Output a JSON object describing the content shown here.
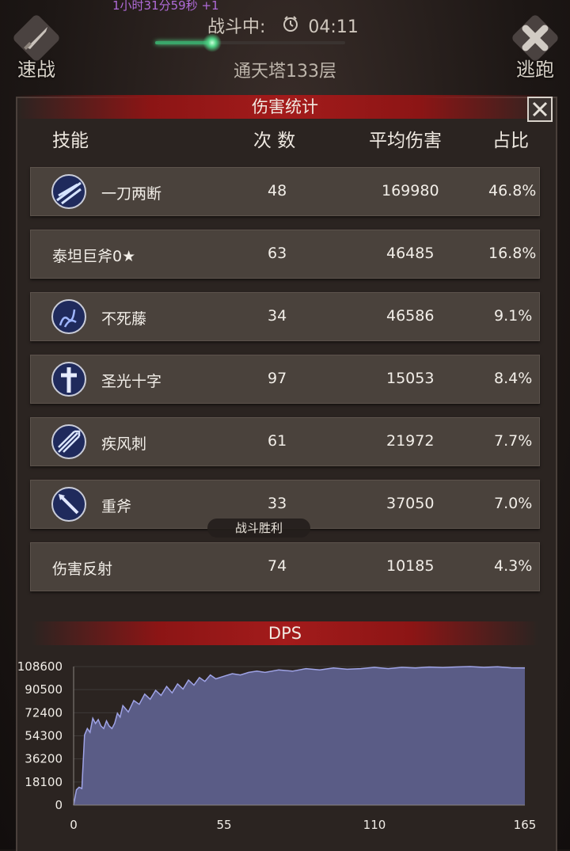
{
  "hud": {
    "top_timer": "1小时31分59秒 +1",
    "quick_battle_label": "速战",
    "escape_label": "逃跑",
    "battle_status_label": "战斗中:",
    "battle_time": "04:11",
    "progress_fraction": 0.3,
    "level_name": "通天塔133层"
  },
  "panel": {
    "title": "伤害统计",
    "columns": [
      "技能",
      "次 数",
      "平均伤害",
      "占比"
    ],
    "rows": [
      {
        "name": "一刀两断",
        "count": "48",
        "avg": "169980",
        "pct": "46.8%",
        "icon": "slash-icon"
      },
      {
        "name": "泰坦巨斧0★",
        "count": "63",
        "avg": "46485",
        "pct": "16.8%",
        "icon": ""
      },
      {
        "name": "不死藤",
        "count": "34",
        "avg": "46586",
        "pct": "9.1%",
        "icon": "vine-icon"
      },
      {
        "name": "圣光十字",
        "count": "97",
        "avg": "15053",
        "pct": "8.4%",
        "icon": "holy-cross-icon"
      },
      {
        "name": "疾风刺",
        "count": "61",
        "avg": "21972",
        "pct": "7.7%",
        "icon": "gale-stab-icon"
      },
      {
        "name": "重斧",
        "count": "33",
        "avg": "37050",
        "pct": "7.0%",
        "icon": "heavy-axe-icon"
      },
      {
        "name": "伤害反射",
        "count": "74",
        "avg": "10185",
        "pct": "4.3%",
        "icon": ""
      }
    ],
    "victory_label": "战斗胜利",
    "dps_title": "DPS"
  },
  "colors": {
    "ribbon": "#a31b1b",
    "chart_fill": "#5a5c86",
    "chart_line": "#9fa3e6",
    "progress": "#3aa66a"
  },
  "chart_data": {
    "type": "area",
    "title": "DPS",
    "xlabel": "",
    "ylabel": "",
    "xlim": [
      0,
      165
    ],
    "ylim": [
      0,
      108600
    ],
    "xticks": [
      0,
      55,
      110,
      165
    ],
    "yticks": [
      0,
      18100,
      36200,
      54300,
      72400,
      90500,
      108600
    ],
    "grid": true,
    "x": [
      0,
      1,
      2,
      3,
      4,
      5,
      6,
      7,
      8,
      9,
      10,
      11,
      12,
      13,
      14,
      15,
      16,
      17,
      18,
      20,
      22,
      24,
      26,
      28,
      30,
      32,
      34,
      36,
      38,
      40,
      42,
      44,
      46,
      48,
      50,
      52,
      55,
      58,
      61,
      64,
      67,
      70,
      75,
      80,
      85,
      90,
      95,
      100,
      105,
      110,
      115,
      120,
      125,
      130,
      135,
      140,
      145,
      150,
      155,
      160,
      165
    ],
    "y": [
      0,
      12000,
      14000,
      13000,
      55000,
      60000,
      57000,
      68000,
      64000,
      67000,
      62000,
      60000,
      66000,
      62000,
      60000,
      64000,
      72000,
      69000,
      78000,
      73000,
      82000,
      79000,
      87000,
      83000,
      90000,
      86000,
      93000,
      88000,
      95000,
      91000,
      98000,
      94000,
      100000,
      97000,
      102000,
      99000,
      101000,
      103000,
      102000,
      104000,
      105000,
      104000,
      106000,
      105000,
      107000,
      106000,
      107500,
      106500,
      107000,
      108000,
      107000,
      108000,
      107500,
      108200,
      107800,
      108300,
      108600,
      108000,
      108400,
      107600,
      107500
    ]
  }
}
